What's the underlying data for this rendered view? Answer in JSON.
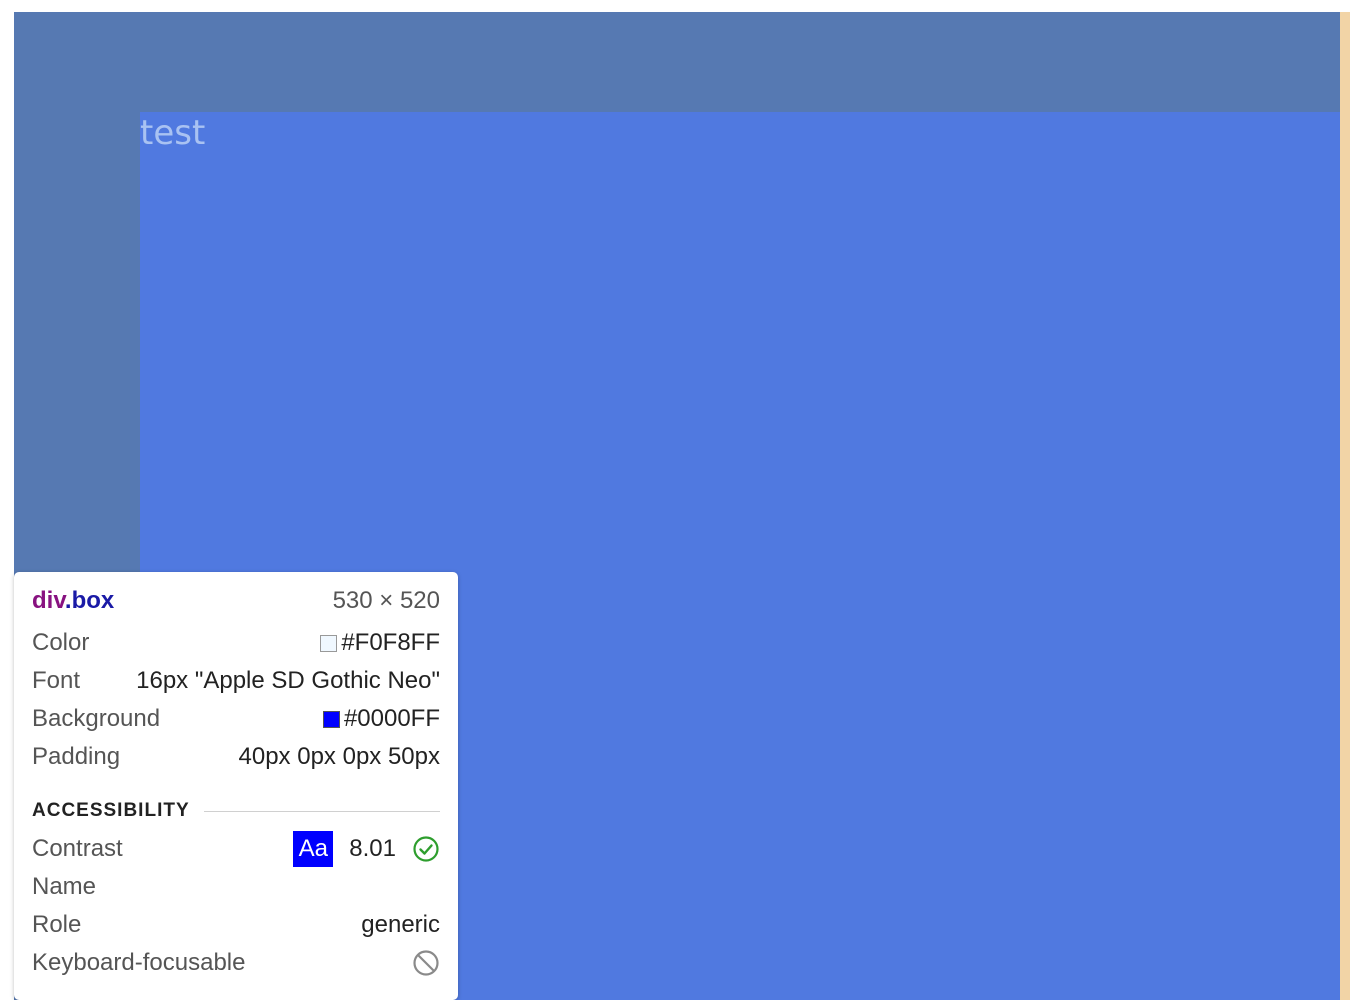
{
  "page": {
    "box_text": "test",
    "colors": {
      "padding_highlight": "#5679b2",
      "content_highlight": "#5079e0",
      "margin_highlight": "#f2d4a6",
      "text_on_box": "#a9c2f2"
    }
  },
  "inspector": {
    "element_tag": "div",
    "element_class": ".box",
    "size": "530 × 520",
    "rows": [
      {
        "label": "Color",
        "value": "#F0F8FF",
        "swatch": "#F0F8FF"
      },
      {
        "label": "Font",
        "value": "16px \"Apple SD Gothic Neo\""
      },
      {
        "label": "Background",
        "value": "#0000FF",
        "swatch": "#0000FF"
      },
      {
        "label": "Padding",
        "value": "40px 0px 0px 50px"
      }
    ],
    "accessibility": {
      "section_title": "ACCESSIBILITY",
      "contrast_label": "Contrast",
      "contrast_badge": "Aa",
      "contrast_badge_bg": "#0000FF",
      "contrast_value": "8.01",
      "contrast_icon": "check-circle-icon",
      "name_label": "Name",
      "name_value": "",
      "role_label": "Role",
      "role_value": "generic",
      "focusable_label": "Keyboard-focusable",
      "focusable_icon": "not-allowed-icon"
    }
  }
}
